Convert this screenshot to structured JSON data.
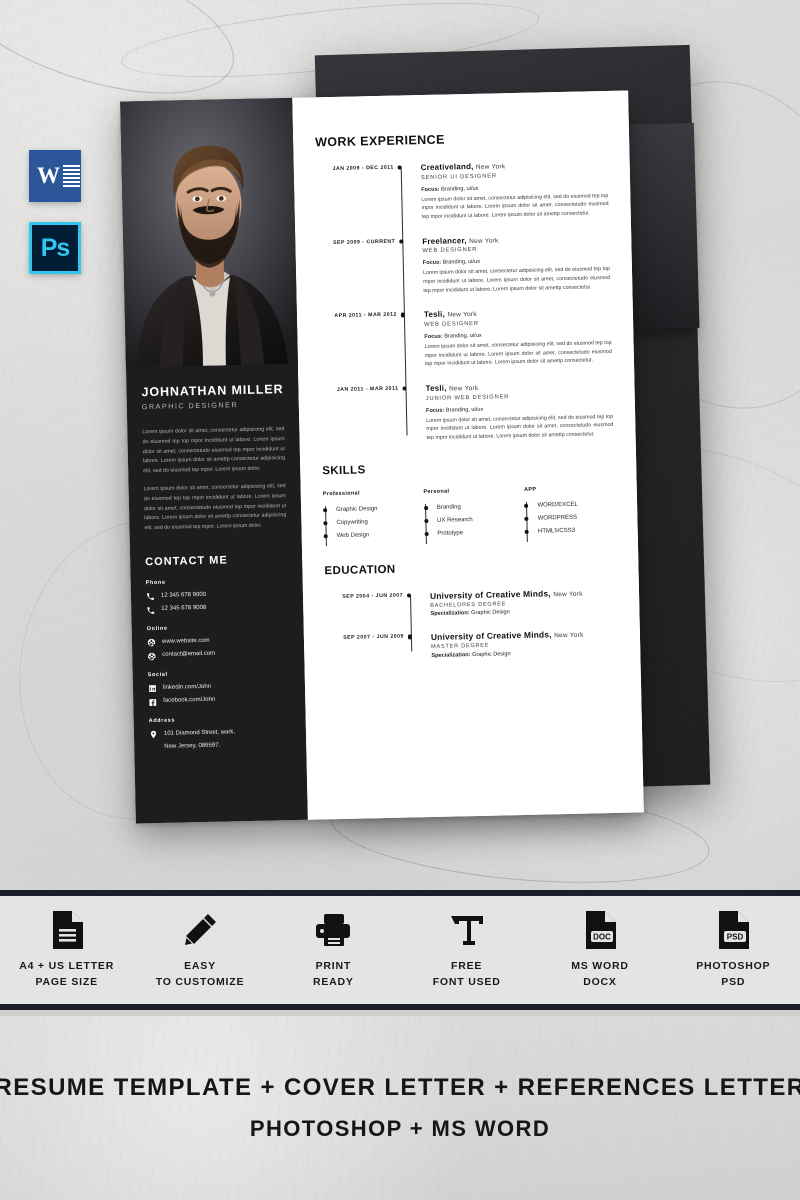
{
  "background": {
    "surface": "marble",
    "envelope_color": "#26262a",
    "card_color": "#ffffff"
  },
  "badges": [
    {
      "name": "ms-word-badge",
      "label": "W",
      "color": "#2b579a"
    },
    {
      "name": "photoshop-badge",
      "label": "Ps",
      "color": "#001e36",
      "accent": "#31c5f0"
    }
  ],
  "resume": {
    "sidebar": {
      "name": "JOHNATHAN MILLER",
      "role": "GRAPHIC DESIGNER",
      "bio": [
        "Lorem ipsum dolor sit amet, consectetur adipisicing elit, sed do eiusmod tep top mpor incididunt ut labore. Lorem ipsum dolor sit amet, consectetudo eiusmod tep mpor incididunt ut labore. Lorem ipsum dolor sit amettp consectetur adipisicing elit, sed do eiusmod tep mpor. Lorem ipsum dolor.",
        "Lorem ipsum dolor sit amet, consectetur adipisicing elit, sed do eiusmod tep top mpor incididunt ut labore. Lorem ipsum dolor sit amet, consectetudo eiusmod tep mpor incididunt ut labore. Lorem ipsum dolor sit amettp consectetur adipisicing elit, sed do eiusmod tep mpor. Lorem ipsum dolor."
      ],
      "contact_title": "CONTACT ME",
      "groups": [
        {
          "label": "Phone",
          "icon": "phone-icon",
          "items": [
            "12 345 678 9000",
            "12 345 678 9008"
          ]
        },
        {
          "label": "Online",
          "icon": "globe-icon",
          "items": [
            "www.website.com",
            "contact@email.com"
          ]
        },
        {
          "label": "Social",
          "icon": "social-icon",
          "items": [
            "linkedin.com/John",
            "facebook.com/John"
          ]
        },
        {
          "label": "Address",
          "icon": "pin-icon",
          "items": [
            "101 Diamond Street, wark,",
            "New Jersey, 086597."
          ]
        }
      ]
    },
    "work": {
      "title": "WORK EXPERIENCE",
      "focus_label": "Focus:",
      "focus_value": "Branding, ui/ux",
      "description": "Lorem ipsum dolor sit amet, consectetur adipisicing elit, sed do eiusmod tep top mpor incididunt ut labore. Lorem ipsum dolor sit amet, consectetudo eiusmod tep mpor incididunt ut labore. Lorem ipsum dolor sit amettp consectetur.",
      "items": [
        {
          "date": "JAN 2009 - DEC 2011",
          "org": "Creativeland,",
          "city": "New York",
          "position": "SENIOR UI DESIGNER"
        },
        {
          "date": "SEP 2009 - CURRENT",
          "org": "Freelancer,",
          "city": "New York",
          "position": "WEB DESIGNER"
        },
        {
          "date": "APR 2011 - MAR 2012",
          "org": "Tesli,",
          "city": "New York",
          "position": "WEB DESIGNER"
        },
        {
          "date": "JAN 2011 - MAR 2011",
          "org": "Tesli,",
          "city": "New York",
          "position": "JUNIOR WEB DESIGNER"
        }
      ]
    },
    "skills": {
      "title": "SKILLS",
      "columns": [
        {
          "head": "Professional",
          "items": [
            "Graphic Design",
            "Copywriting",
            "Web Design"
          ]
        },
        {
          "head": "Personal",
          "items": [
            "Branding",
            "UX Research",
            "Prototype"
          ]
        },
        {
          "head": "APP",
          "items": [
            "WORD/EXCEL",
            "WORDPRESS",
            "HTML5/CSS3"
          ]
        }
      ]
    },
    "education": {
      "title": "EDUCATION",
      "spec_label": "Specialization:",
      "items": [
        {
          "date": "SEP 2004 - JUN 2007",
          "org": "University of Creative Minds,",
          "city": "New York",
          "degree": "BACHELORES DEGREE",
          "spec": "Graphic Design"
        },
        {
          "date": "SEP 2007 - JUN 2009",
          "org": "University of Creative Minds,",
          "city": "New York",
          "degree": "MASTER DEGREE",
          "spec": "Graphic Design"
        }
      ]
    }
  },
  "features": [
    {
      "icon": "document-icon",
      "line1": "A4 + US LETTER",
      "line2": "PAGE SIZE"
    },
    {
      "icon": "pencil-icon",
      "line1": "EASY",
      "line2": "TO CUSTOMIZE"
    },
    {
      "icon": "printer-icon",
      "line1": "PRINT",
      "line2": "READY"
    },
    {
      "icon": "font-t-icon",
      "line1": "FREE",
      "line2": "FONT USED"
    },
    {
      "icon": "doc-file-icon",
      "line1": "MS WORD",
      "line2": "DOCX"
    },
    {
      "icon": "psd-file-icon",
      "line1": "PHOTOSHOP",
      "line2": "PSD"
    }
  ],
  "banner": {
    "line1": "RESUME TEMPLATE + COVER LETTER + REFERENCES LETTER",
    "line2": "PHOTOSHOP + MS WORD"
  }
}
